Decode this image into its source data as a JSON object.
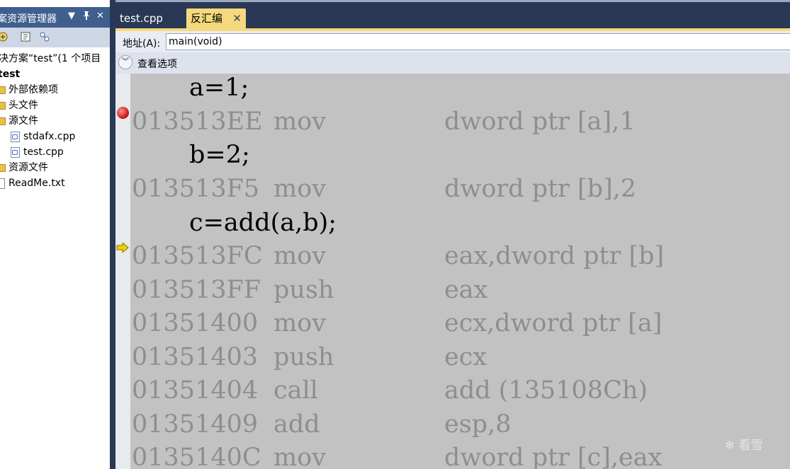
{
  "solution_explorer": {
    "title": "案资源管理器",
    "dropdown_glyph": "▼",
    "pin_glyph": "ᚙ",
    "close_glyph": "✕",
    "tree": {
      "solution": "决方案“test”(1 个项目",
      "project": "test",
      "items": [
        {
          "label": "外部依赖项",
          "kind": "folder"
        },
        {
          "label": "头文件",
          "kind": "folder"
        },
        {
          "label": "源文件",
          "kind": "folder"
        },
        {
          "label": "stdafx.cpp",
          "kind": "cpp"
        },
        {
          "label": "test.cpp",
          "kind": "cpp"
        },
        {
          "label": "资源文件",
          "kind": "folder"
        },
        {
          "label": "ReadMe.txt",
          "kind": "txt"
        }
      ]
    }
  },
  "tabs": [
    {
      "label": "test.cpp",
      "active": false
    },
    {
      "label": "反汇编",
      "active": true,
      "close": "✕"
    }
  ],
  "address": {
    "label": "地址(A):",
    "value": "main(void)"
  },
  "options": {
    "label": "查看选项",
    "toggle_glyph": "︾"
  },
  "disassembly": {
    "lines": [
      {
        "type": "src",
        "text": "a=1;"
      },
      {
        "type": "asm",
        "addr": "013513EE",
        "op": "mov",
        "arg": "dword ptr [a],1"
      },
      {
        "type": "src",
        "text": "b=2;"
      },
      {
        "type": "asm",
        "addr": "013513F5",
        "op": "mov",
        "arg": "dword ptr [b],2"
      },
      {
        "type": "src",
        "text": "c=add(a,b);"
      },
      {
        "type": "asm",
        "addr": "013513FC",
        "op": "mov",
        "arg": "eax,dword ptr [b]"
      },
      {
        "type": "asm",
        "addr": "013513FF",
        "op": "push",
        "arg": "eax"
      },
      {
        "type": "asm",
        "addr": "01351400",
        "op": "mov",
        "arg": "ecx,dword ptr [a]"
      },
      {
        "type": "asm",
        "addr": "01351403",
        "op": "push",
        "arg": "ecx"
      },
      {
        "type": "asm",
        "addr": "01351404",
        "op": "call",
        "arg": "add (135108Ch)"
      },
      {
        "type": "asm",
        "addr": "01351409",
        "op": "add",
        "arg": "esp,8"
      },
      {
        "type": "asm",
        "addr": "0135140C",
        "op": "mov",
        "arg": "dword ptr [c],eax"
      }
    ]
  },
  "watermark": "看雪",
  "colors": {
    "breakpoint": "#c81818",
    "pointer": "#f4d000",
    "active_tab": "#f5d97e"
  }
}
